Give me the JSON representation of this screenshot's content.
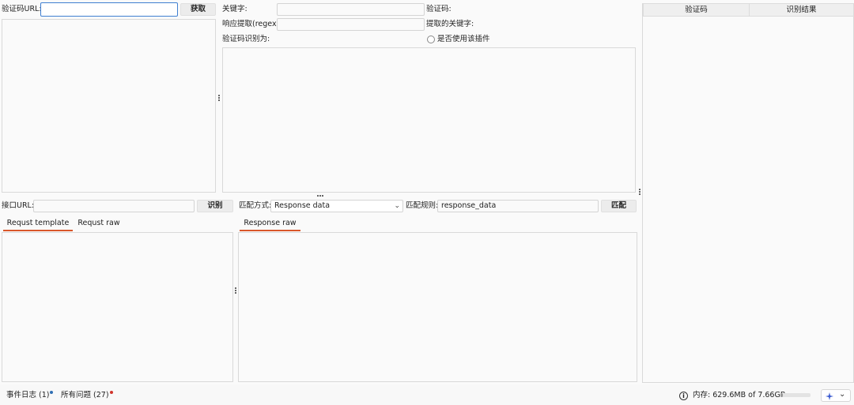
{
  "captcha": {
    "url_label": "验证码URL:",
    "url_value": "",
    "fetch_button": "获取"
  },
  "recognition": {
    "keyword_label": "关键字:",
    "keyword_value": "",
    "captcha_label": "验证码:",
    "regex_label": "响应提取(regex):",
    "regex_value": "",
    "extracted_label": "提取的关键字:",
    "recognized_label": "验证码识别为:",
    "use_plugin_label": "是否使用该插件"
  },
  "results_table": {
    "columns": [
      "验证码",
      "识别结果"
    ]
  },
  "api": {
    "url_label": "接口URL:",
    "url_value": "",
    "identify_button": "识别",
    "tabs": [
      "Requst template",
      "Requst raw"
    ]
  },
  "match": {
    "mode_label": "匹配方式:",
    "mode_value": "Response data",
    "rule_label": "匹配规则:",
    "rule_value": "response_data",
    "match_button": "匹配",
    "tabs": [
      "Response raw"
    ]
  },
  "status": {
    "event_log": "事件日志 (1)",
    "issues": "所有问题 (27)",
    "memory": "内存: 629.6MB of 7.66GB",
    "memory_fraction": 0.08,
    "event_dot_color": "#2f6fb3",
    "issues_dot_color": "#d0342c"
  }
}
